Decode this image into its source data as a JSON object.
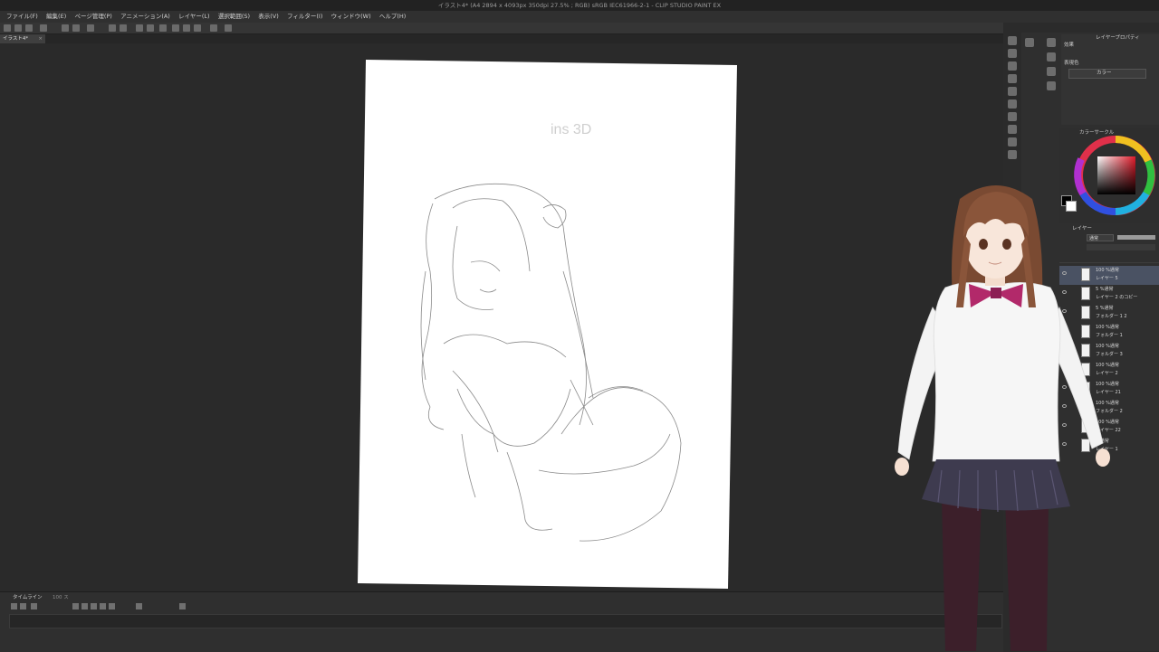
{
  "window": {
    "title": "イラスト4* (A4 2894 x 4093px 350dpi 27.5% ; RGB) sRGB IEC61966-2-1 - CLIP STUDIO PAINT EX"
  },
  "menu": [
    "ファイル(F)",
    "編集(E)",
    "ページ管理(P)",
    "アニメーション(A)",
    "レイヤー(L)",
    "選択範囲(S)",
    "表示(V)",
    "フィルター(I)",
    "ウィンドウ(W)",
    "ヘルプ(H)"
  ],
  "document_tab": {
    "label": "イラスト4*",
    "close": "×"
  },
  "canvas": {
    "sketch_text": "ins 3D",
    "paper_color": "#ffffff"
  },
  "timeline": {
    "tab_label": "タイムライン",
    "tab2_label": "100 ス"
  },
  "effect_panel": {
    "tab_effect": "効果",
    "tab_properties": "レイヤープロパティ",
    "expression_label": "表現色",
    "expression_value": "カラー"
  },
  "color_panel": {
    "title": "カラーサークル",
    "main_color": "#000000",
    "sub_color": "#ffffff"
  },
  "layer_panel": {
    "title": "レイヤー",
    "blend_mode": "通常",
    "rows": [
      {
        "line1": "100 %通常",
        "line2": "レイヤー 5",
        "selected": true
      },
      {
        "line1": "5 %通常",
        "line2": "レイヤー 2 のコピー",
        "selected": false
      },
      {
        "line1": "5 %通常",
        "line2": "フォルダー 1 2",
        "selected": false
      },
      {
        "line1": "100 %通常",
        "line2": "フォルダー 1",
        "selected": false
      },
      {
        "line1": "100 %通常",
        "line2": "フォルダー 3",
        "selected": false
      },
      {
        "line1": "100 %通常",
        "line2": "レイヤー 2",
        "selected": false
      },
      {
        "line1": "100 %通常",
        "line2": "レイヤー 21",
        "selected": false
      },
      {
        "line1": "100 %通常",
        "line2": "フォルダー 2",
        "selected": false
      },
      {
        "line1": "100 %通常",
        "line2": "レイヤー 22",
        "selected": false
      },
      {
        "line1": "%通常",
        "line2": "レイヤー 1",
        "selected": false
      }
    ]
  },
  "colors": {
    "bg": "#2b2b2b",
    "panel": "#2f2f2f",
    "selected_layer": "#4a5263",
    "tie": "#b2296a",
    "skirt": "#3e3b4f",
    "tights": "#3c1f2a"
  }
}
